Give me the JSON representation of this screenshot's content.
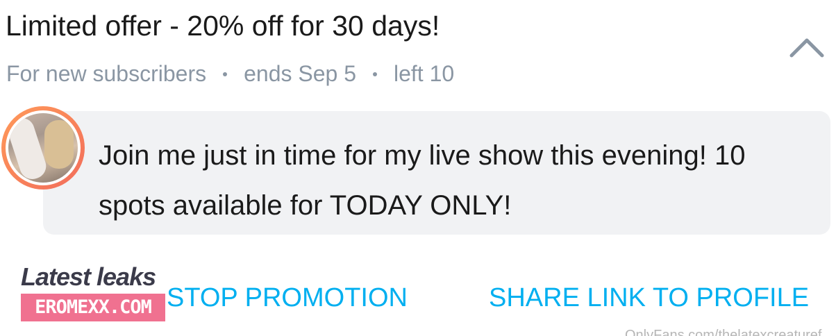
{
  "offer": {
    "title": "Limited offer - 20% off for 30 days!",
    "audience": "For new subscribers",
    "ends": "ends Sep 5",
    "remaining": "left 10"
  },
  "message": {
    "text": "Join me just in time for my live show this evening! 10 spots available for TODAY ONLY!"
  },
  "icons": {
    "collapse": "chevron-up-icon",
    "avatar": "avatar"
  },
  "actions": {
    "stop_promotion": "STOP PROMOTION",
    "share_link": "SHARE LINK TO PROFILE"
  },
  "watermark": {
    "heading": "Latest leaks",
    "badge": "EROMEXX.COM"
  },
  "footer": {
    "url": "OnlyFans.com/thelatexcreaturef"
  },
  "colors": {
    "accent": "#00aff0",
    "muted_text": "#8a96a3",
    "message_bg": "#f1f2f4",
    "avatar_ring": "#f26d5b",
    "watermark_badge": "#f07190"
  }
}
